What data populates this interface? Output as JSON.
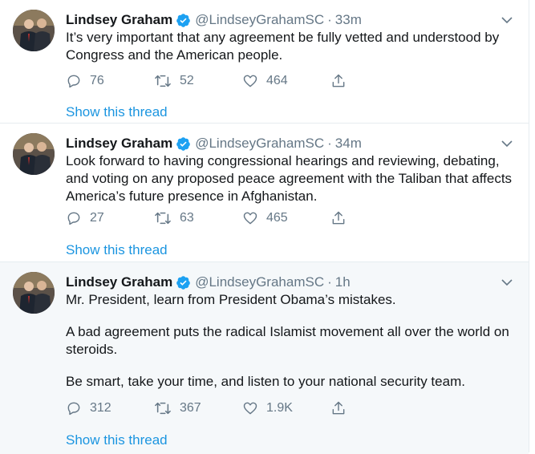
{
  "colors": {
    "link": "#1b95e0",
    "muted": "#657786",
    "verified": "#1da1f2"
  },
  "tweets": [
    {
      "name": "Lindsey Graham",
      "handle": "@LindseyGrahamSC",
      "time": "33m",
      "paragraphs": [
        "It’s very important that any agreement be fully vetted and understood by Congress and the American people."
      ],
      "replies": "76",
      "retweets": "52",
      "likes": "464",
      "show_thread": "Show this thread"
    },
    {
      "name": "Lindsey Graham",
      "handle": "@LindseyGrahamSC",
      "time": "34m",
      "paragraphs": [
        "Look forward to having congressional hearings and reviewing, debating, and voting on any proposed peace agreement with the Taliban that affects America’s future presence in Afghanistan."
      ],
      "replies": "27",
      "retweets": "63",
      "likes": "465",
      "show_thread": "Show this thread"
    },
    {
      "name": "Lindsey Graham",
      "handle": "@LindseyGrahamSC",
      "time": "1h",
      "paragraphs": [
        "Mr. President, learn from President Obama’s mistakes.",
        "A bad agreement puts the radical Islamist movement all over the world on steroids.",
        "Be smart, take your time, and listen to your national security team."
      ],
      "replies": "312",
      "retweets": "367",
      "likes": "1.9K",
      "show_thread": "Show this thread"
    }
  ]
}
